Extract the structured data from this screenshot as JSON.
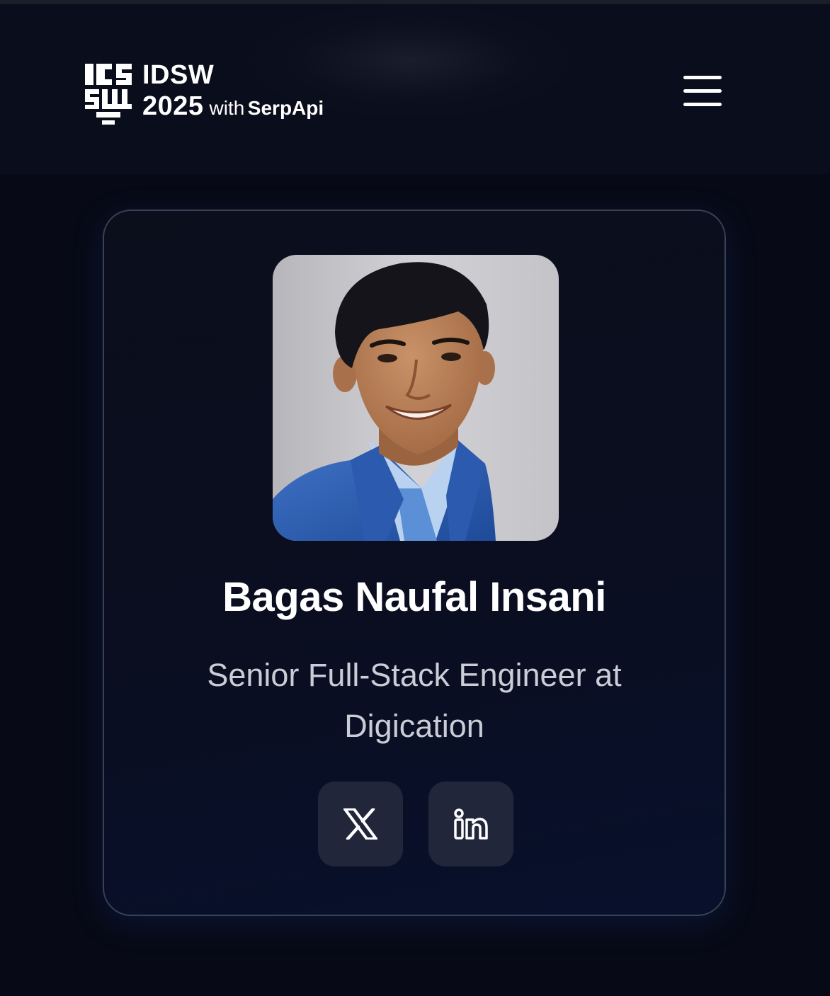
{
  "header": {
    "logo_line1": "IDSW",
    "logo_year": "2025",
    "logo_with": "with",
    "logo_partner": "SerpApi",
    "menu_icon": "hamburger-menu-icon"
  },
  "speaker": {
    "name": "Bagas Naufal Insani",
    "role_line1": "Senior Full-Stack Engineer at",
    "role_line2": "Digication",
    "photo": "speaker-portrait",
    "socials": [
      {
        "icon": "x-icon"
      },
      {
        "icon": "linkedin-icon"
      }
    ]
  },
  "colors": {
    "background": "#070a16",
    "card_border": "#3a4152",
    "social_button_bg": "#21263a",
    "role_text": "#c9cdd6"
  }
}
